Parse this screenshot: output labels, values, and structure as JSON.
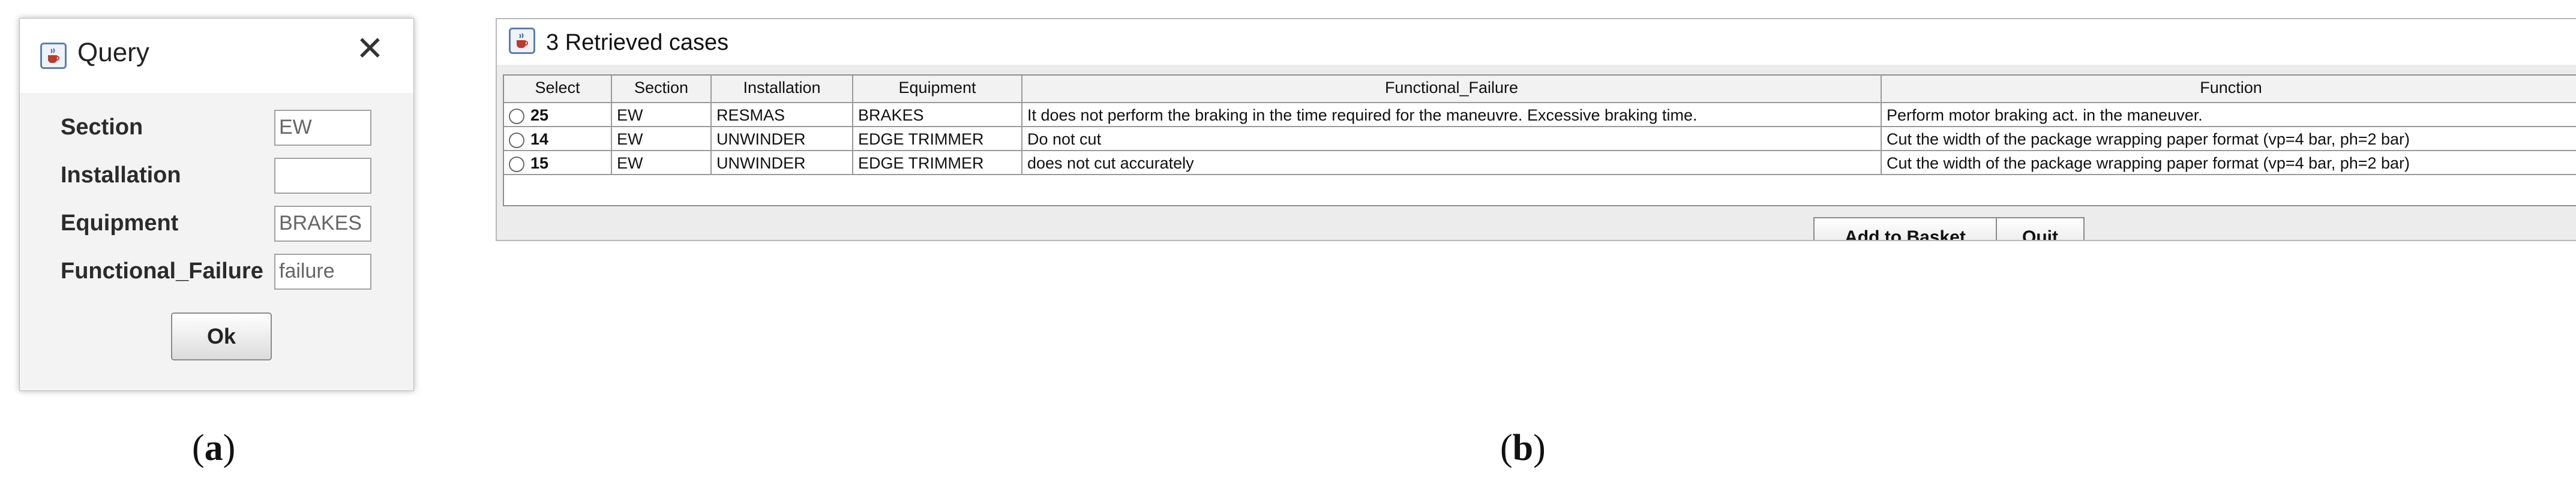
{
  "query_dialog": {
    "title": "Query",
    "close_glyph": "✕",
    "fields": [
      {
        "label": "Section",
        "value": "EW"
      },
      {
        "label": "Installation",
        "value": ""
      },
      {
        "label": "Equipment",
        "value": "BRAKES"
      },
      {
        "label": "Functional_Failure",
        "value": "failure"
      }
    ],
    "ok_label": "Ok"
  },
  "captions": {
    "a_open": "(",
    "a_letter": "a",
    "a_close": ")",
    "b_open": "(",
    "b_letter": "b",
    "b_close": ")"
  },
  "cases_window": {
    "title": "3 Retrieved cases",
    "columns": [
      "Select",
      "Section",
      "Installation",
      "Equipment",
      "Functional_Failure",
      "Function"
    ],
    "rows": [
      {
        "select": "25",
        "section": "EW",
        "installation": "RESMAS",
        "equipment": "BRAKES",
        "functional_failure": "It does not perform the braking in the time required for the maneuvre. Excessive braking time.",
        "function": "Perform motor braking act. in the maneuver."
      },
      {
        "select": "14",
        "section": "EW",
        "installation": "UNWINDER",
        "equipment": "EDGE TRIMMER",
        "functional_failure": "Do not cut",
        "function": "Cut the width of the package wrapping paper format  (vp=4 bar, ph=2 bar)"
      },
      {
        "select": "15",
        "section": "EW",
        "installation": "UNWINDER",
        "equipment": "EDGE TRIMMER",
        "functional_failure": "does not cut accurately",
        "function": "Cut the width of the package wrapping paper format  (vp=4 bar, ph=2 bar)"
      }
    ],
    "add_to_basket_label": "Add to Basket",
    "quit_label": "Quit"
  },
  "icons": {
    "app_icon": "java-coffee-cup-icon",
    "close": "close-icon",
    "radio": "radio-button-icon"
  },
  "colors": {
    "dialog_bg": "#f3f3f3",
    "grid_border": "#9a9a9a",
    "icon_blue": "#5e7fa8"
  }
}
